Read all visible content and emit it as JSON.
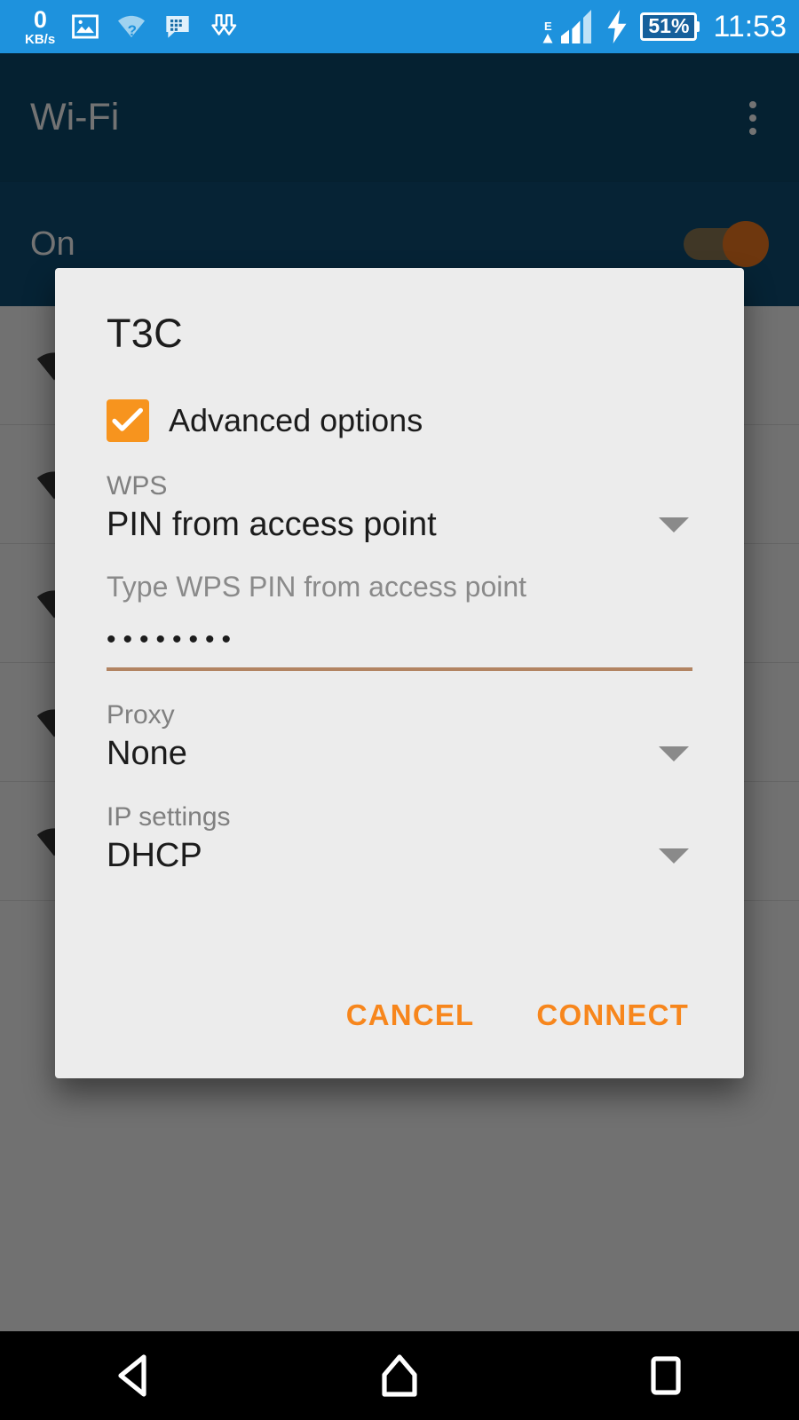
{
  "statusbar": {
    "network_speed_value": "0",
    "network_speed_unit": "KB/s",
    "icons": [
      "gallery-icon",
      "wifi-question-icon",
      "bbm-message-icon",
      "download-arrows-icon"
    ],
    "signal_type": "E",
    "battery_percent": "51%",
    "clock": "11:53"
  },
  "appbar": {
    "title": "Wi-Fi",
    "overflow_label": "More options"
  },
  "switchbar": {
    "label": "On",
    "state": "on"
  },
  "wifi_list": {
    "rows": [
      {
        "ssid": ""
      },
      {
        "ssid": ""
      },
      {
        "ssid": ""
      },
      {
        "ssid": ""
      },
      {
        "ssid": ""
      }
    ]
  },
  "dialog": {
    "title": "T3C",
    "advanced_options": {
      "label": "Advanced options",
      "checked": true
    },
    "wps": {
      "label": "WPS",
      "value": "PIN from access point"
    },
    "wps_pin": {
      "label": "Type WPS PIN from access point",
      "value": "••••••••"
    },
    "proxy": {
      "label": "Proxy",
      "value": "None"
    },
    "ip_settings": {
      "label": "IP settings",
      "value": "DHCP"
    },
    "cancel_label": "CANCEL",
    "connect_label": "CONNECT"
  },
  "navbar": {
    "back": "back-icon",
    "home": "home-icon",
    "recents": "recents-icon"
  },
  "colors": {
    "status_bar": "#1e92dd",
    "app_bar": "#0d4a6e",
    "switch_bar": "#0f4f75",
    "accent": "#f7861c",
    "checkbox": "#f7941e",
    "input_underline": "#b28462",
    "dialog_bg": "#ececec"
  }
}
